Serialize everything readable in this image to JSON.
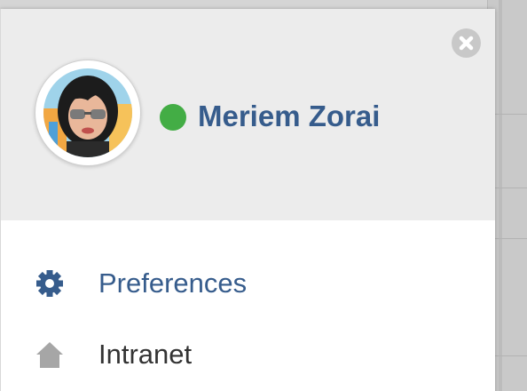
{
  "user": {
    "name": "Meriem Zorai",
    "status": "online"
  },
  "close_button": {
    "icon": "close-icon"
  },
  "menu": {
    "items": [
      {
        "label": "Preferences",
        "icon": "gear-icon"
      },
      {
        "label": "Intranet",
        "icon": "home-icon"
      }
    ]
  },
  "colors": {
    "accent": "#365c8c",
    "status_online": "#43ad45",
    "header_bg": "#ececec",
    "icon_gray": "#a6a6a6"
  }
}
